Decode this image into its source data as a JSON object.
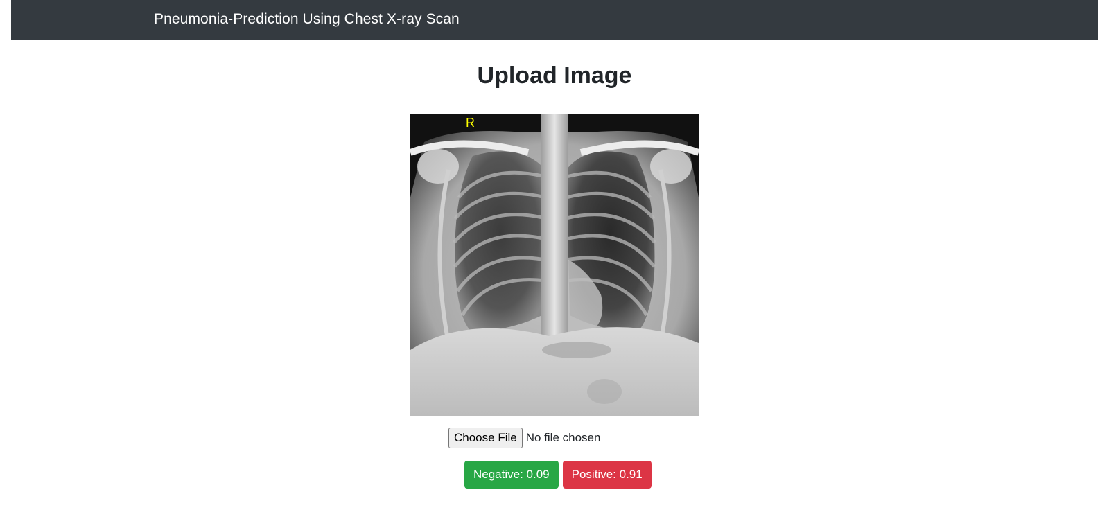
{
  "navbar": {
    "brand": "Pneumonia-Prediction Using Chest X-ray Scan"
  },
  "main": {
    "title": "Upload Image",
    "image_marker": "R",
    "file_input": {
      "button_label": "Choose File",
      "status": "No file chosen"
    },
    "results": {
      "negative_label": "Negative: 0.09",
      "positive_label": "Positive: 0.91"
    }
  },
  "colors": {
    "navbar_bg": "#343a40",
    "negative": "#28a745",
    "positive": "#dc3545"
  }
}
